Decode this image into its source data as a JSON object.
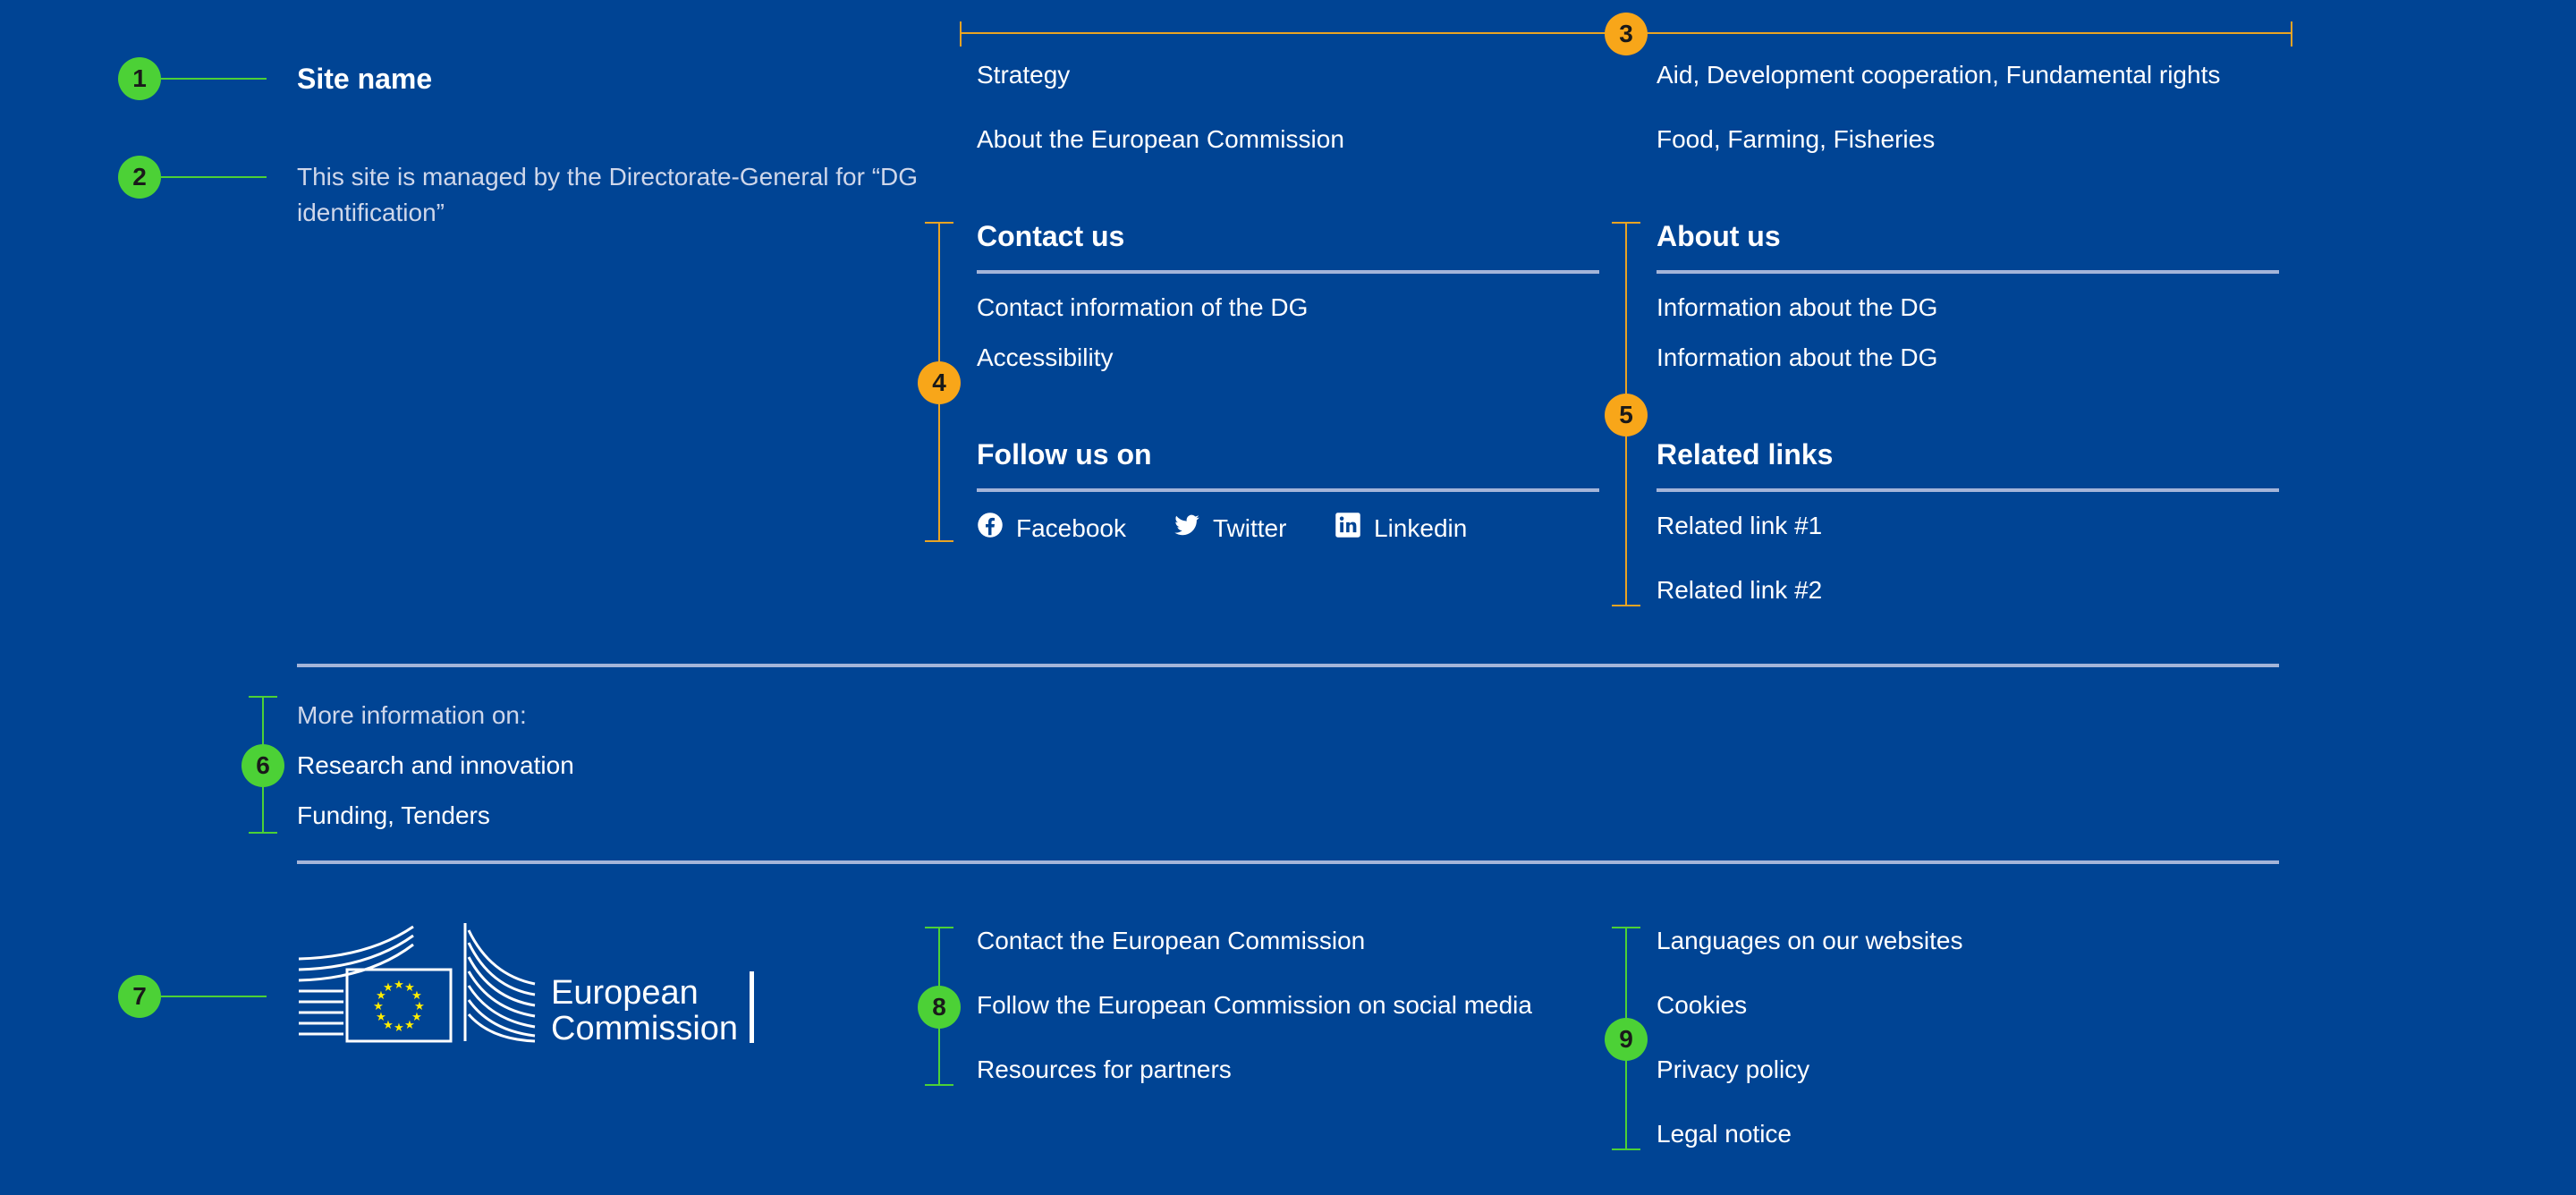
{
  "site": {
    "name": "Site name",
    "managed_text": "This site is managed by the Directorate-General for “DG identification”"
  },
  "top_links": {
    "left": [
      "Strategy",
      "About the European Commission"
    ],
    "right": [
      "Aid, Development cooperation, Fundamental rights",
      "Food, Farming, Fisheries"
    ]
  },
  "contact": {
    "title": "Contact us",
    "links": [
      "Contact information of the DG",
      "Accessibility"
    ]
  },
  "follow": {
    "title": "Follow us on",
    "social": [
      {
        "label": "Facebook",
        "icon": "facebook-icon"
      },
      {
        "label": "Twitter",
        "icon": "twitter-icon"
      },
      {
        "label": "Linkedin",
        "icon": "linkedin-icon"
      }
    ]
  },
  "about": {
    "title": "About us",
    "links": [
      "Information about the DG",
      "Information about the DG"
    ]
  },
  "related": {
    "title": "Related links",
    "links": [
      "Related link #1",
      "Related link #2"
    ]
  },
  "more_info": {
    "label": "More information on:",
    "links": [
      "Research and innovation",
      "Funding, Tenders"
    ]
  },
  "logo": {
    "line1": "European",
    "line2": "Commission"
  },
  "bottom_links": {
    "middle": [
      "Contact the European Commission",
      "Follow the European Commission on social media",
      "Resources for partners"
    ],
    "right": [
      "Languages on our websites",
      "Cookies",
      "Privacy policy",
      "Legal notice"
    ]
  },
  "markers": [
    "1",
    "2",
    "3",
    "4",
    "5",
    "6",
    "7",
    "8",
    "9"
  ],
  "colors": {
    "background": "#004494",
    "marker_green": "#4cd136",
    "marker_orange": "#f8a619",
    "divider": "#a4b5d9",
    "flag_stars": "#ffed00"
  }
}
